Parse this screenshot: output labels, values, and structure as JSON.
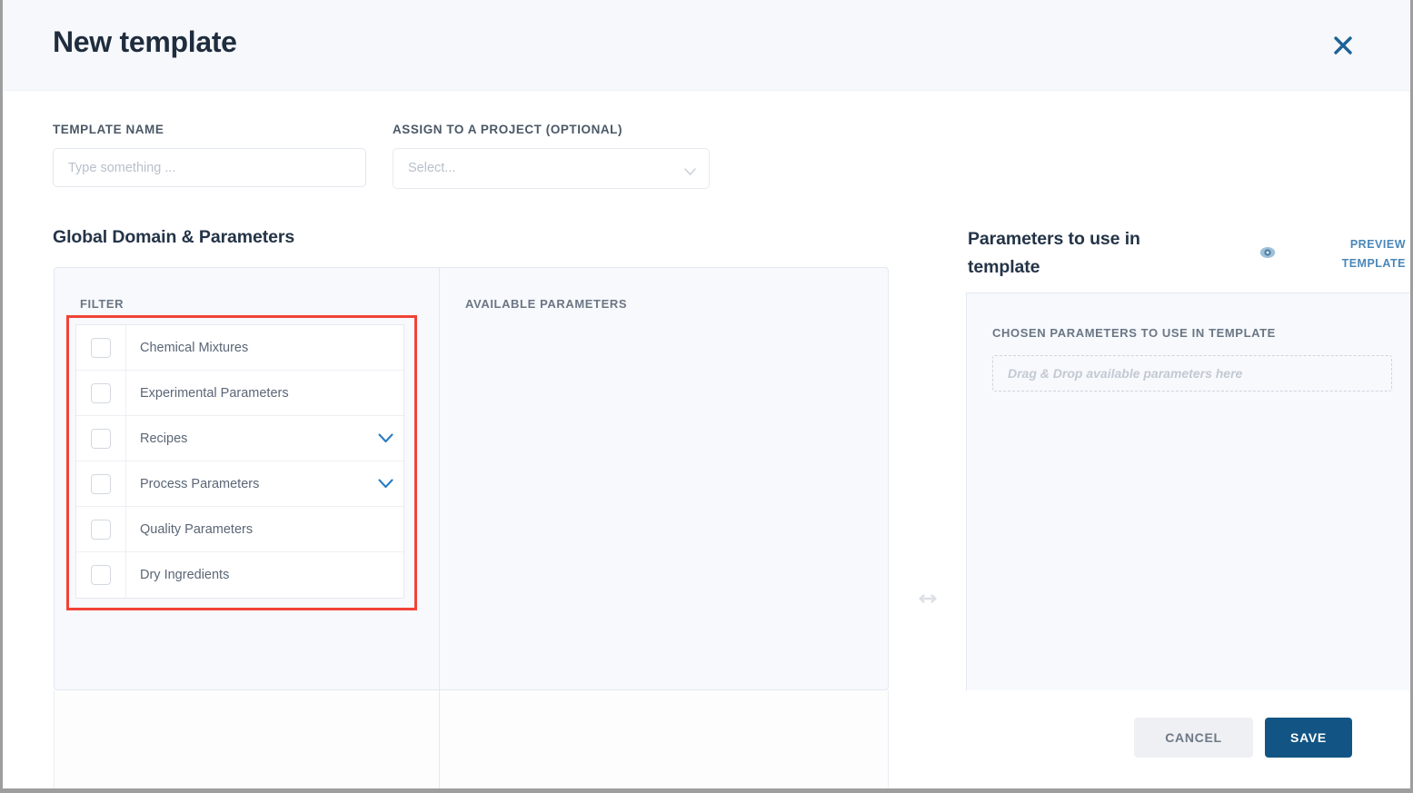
{
  "header": {
    "title": "New template",
    "close_icon": "close-icon"
  },
  "form": {
    "template_name_label": "TEMPLATE NAME",
    "template_name_value": "",
    "template_name_placeholder": "Type something ...",
    "assign_project_label": "ASSIGN TO A PROJECT (OPTIONAL)",
    "assign_project_value": "Select...",
    "assign_project_caret_icon": "chevron-down-icon"
  },
  "left": {
    "section_title": "Global Domain & Parameters",
    "filter_header": "FILTER",
    "available_header": "AVAILABLE PARAMETERS",
    "filters": [
      {
        "label": "Chemical Mixtures",
        "checked": false,
        "expandable": false
      },
      {
        "label": "Experimental Parameters",
        "checked": false,
        "expandable": false
      },
      {
        "label": "Recipes",
        "checked": false,
        "expandable": true
      },
      {
        "label": "Process Parameters",
        "checked": false,
        "expandable": true
      },
      {
        "label": "Quality Parameters",
        "checked": false,
        "expandable": false
      },
      {
        "label": "Dry Ingredients",
        "checked": false,
        "expandable": false
      }
    ],
    "available_parameters": []
  },
  "resize": {
    "icon": "horizontal-resize-icon"
  },
  "right": {
    "section_title": "Parameters to use in template",
    "preview_icon": "preview-eye-icon",
    "preview_link": "PREVIEW TEMPLATE",
    "chosen_header": "CHOSEN PARAMETERS TO USE IN TEMPLATE",
    "dropzone_placeholder": "Drag & Drop available parameters here",
    "chosen_parameters": []
  },
  "footer": {
    "cancel_label": "CANCEL",
    "save_label": "SAVE"
  },
  "annotation": {
    "highlight_color": "#f04337"
  },
  "colors": {
    "accent_blue": "#125584",
    "link_blue": "#4a87b8",
    "header_bg": "#f6f8fc",
    "panel_bg": "#f7f9fd",
    "title_text": "#243447"
  }
}
